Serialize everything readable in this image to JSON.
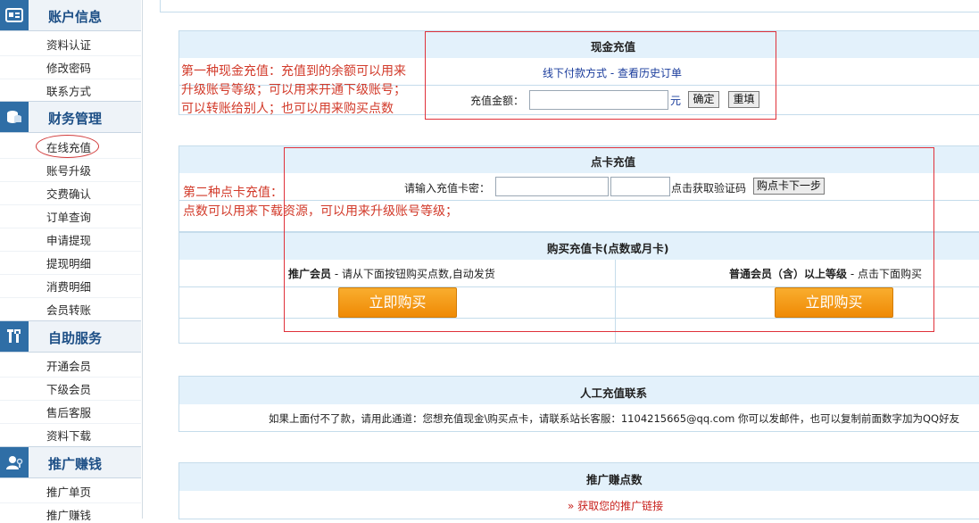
{
  "sidebar": {
    "sections": [
      {
        "title": "账户信息",
        "icon": "id-card-icon",
        "items": [
          "资料认证",
          "修改密码",
          "联系方式"
        ]
      },
      {
        "title": "财务管理",
        "icon": "coins-icon",
        "items": [
          "在线充值",
          "账号升级",
          "交费确认",
          "订单查询",
          "申请提现",
          "提现明细",
          "消费明细",
          "会员转账"
        ]
      },
      {
        "title": "自助服务",
        "icon": "tools-icon",
        "items": [
          "开通会员",
          "下级会员",
          "售后客服",
          "资料下载"
        ]
      },
      {
        "title": "推广赚钱",
        "icon": "user-key-icon",
        "items": [
          "推广单页",
          "推广赚钱"
        ]
      }
    ],
    "active_item": "在线充值"
  },
  "cash": {
    "title": "现金充值",
    "offline_label": "线下付款方式",
    "separator": " - ",
    "history_link": "查看历史订单",
    "amount_label": "充值金额：",
    "amount_value": "",
    "unit": "元",
    "confirm_btn": "确定",
    "reset_btn": "重填",
    "note": [
      "第一种现金充值：充值到的余额可以用来",
      "升级账号等级；可以用来开通下级账号；",
      "可以转账给别人；也可以用来购买点数"
    ]
  },
  "card": {
    "title": "点卡充值",
    "pwd_label": "请输入充值卡密：",
    "pwd_value": "",
    "code_value": "",
    "get_code": "点击获取验证码",
    "next_btn": "购点卡下一步",
    "note": [
      "第二种点卡充值：",
      "点数可以用来下载资源，可以用来升级账号等级；"
    ]
  },
  "buy": {
    "title": "购买充值卡(点数或月卡)",
    "left_strong": "推广会员",
    "left_text": " - 请从下面按钮购买点数,自动发货",
    "right_strong": "普通会员（含）以上等级",
    "right_text": " - 点击下面购买",
    "buy_left": "立即购买",
    "buy_right": "立即购买"
  },
  "manual": {
    "title": "人工充值联系",
    "text": "如果上面付不了款，请用此通道：您想充值现金\\购买点卡，请联系站长客服：1104215665@qq.com 你可以发邮件，也可以复制前面数字加为QQ好友"
  },
  "promo": {
    "title": "推广赚点数",
    "link": "» 获取您的推广链接"
  },
  "colors": {
    "accent": "#2f6ea6",
    "header_bg": "#e3f1fb",
    "annotation": "#e0313a",
    "button_orange": "#f59a13"
  }
}
